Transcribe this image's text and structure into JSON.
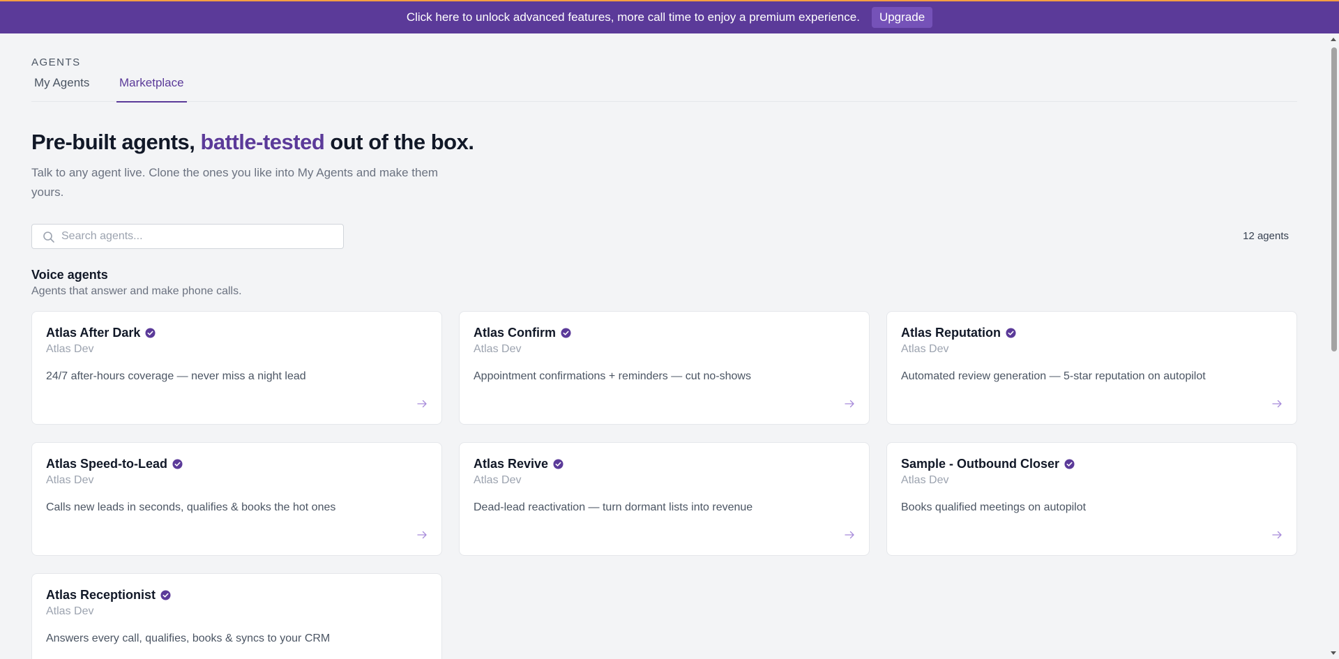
{
  "banner": {
    "message": "Click here to unlock advanced features, more call time to enjoy a premium experience.",
    "button_label": "Upgrade",
    "color": "#5b3a99"
  },
  "page": {
    "section_label": "AGENTS",
    "tabs": [
      {
        "label": "My Agents",
        "active": false
      },
      {
        "label": "Marketplace",
        "active": true
      }
    ],
    "headline": {
      "prefix": "Pre-built agents, ",
      "accent": "battle-tested",
      "suffix": " out of the box.",
      "accent_color": "#5b3a99"
    },
    "subtitle": "Talk to any agent live. Clone the ones you like into My Agents and make them yours.",
    "search": {
      "placeholder": "Search agents...",
      "value": "",
      "icon": "search-icon"
    },
    "agent_count": "12 agents"
  },
  "group": {
    "title": "Voice agents",
    "subtitle": "Agents that answer and make phone calls."
  },
  "agents": [
    {
      "name": "Atlas After Dark",
      "author": "Atlas Dev",
      "description": "24/7 after-hours coverage — never miss a night lead"
    },
    {
      "name": "Atlas Confirm",
      "author": "Atlas Dev",
      "description": "Appointment confirmations + reminders — cut no-shows"
    },
    {
      "name": "Atlas Reputation",
      "author": "Atlas Dev",
      "description": "Automated review generation — 5-star reputation on autopilot"
    },
    {
      "name": "Atlas Speed-to-Lead",
      "author": "Atlas Dev",
      "description": "Calls new leads in seconds, qualifies & books the hot ones"
    },
    {
      "name": "Atlas Revive",
      "author": "Atlas Dev",
      "description": "Dead-lead reactivation — turn dormant lists into revenue"
    },
    {
      "name": "Sample - Outbound Closer",
      "author": "Atlas Dev",
      "description": "Books qualified meetings on autopilot"
    },
    {
      "name": "Atlas Receptionist",
      "author": "Atlas Dev",
      "description": "Answers every call, qualifies, books & syncs to your CRM"
    }
  ]
}
